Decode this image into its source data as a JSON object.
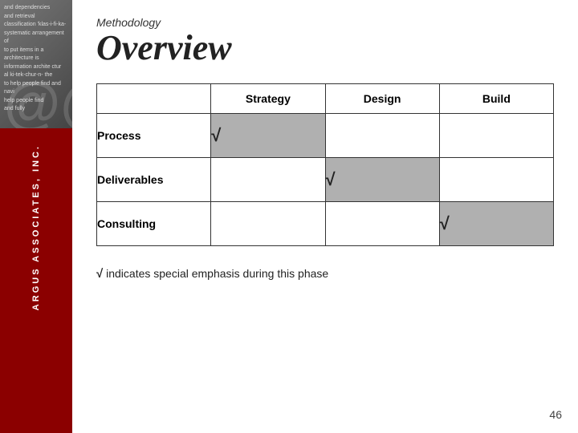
{
  "sidebar": {
    "brand": "ARGUS ASSOCIATES, INC.",
    "at_symbol": "@@"
  },
  "header": {
    "methodology_label": "Methodology",
    "overview_title": "Overview"
  },
  "table": {
    "columns": [
      "",
      "Strategy",
      "Design",
      "Build"
    ],
    "rows": [
      {
        "label": "Process",
        "cells": [
          "highlighted",
          "normal",
          "normal"
        ]
      },
      {
        "label": "Deliverables",
        "cells": [
          "normal",
          "highlighted",
          "normal"
        ]
      },
      {
        "label": "Consulting",
        "cells": [
          "normal",
          "normal",
          "highlighted"
        ]
      }
    ],
    "check_symbol": "√"
  },
  "footnote": {
    "check": "√",
    "text": " indicates special emphasis during this phase"
  },
  "page_number": "46"
}
